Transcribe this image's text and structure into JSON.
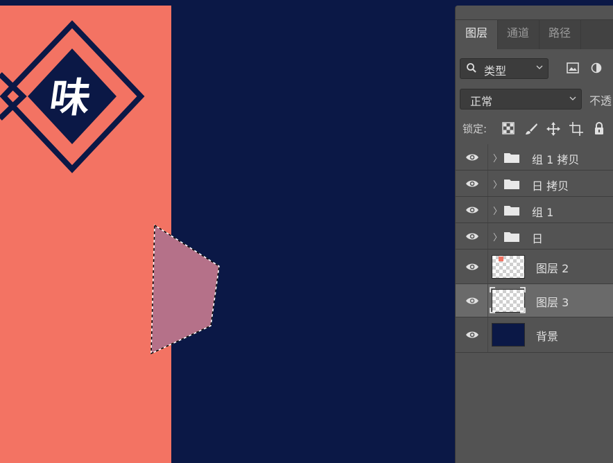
{
  "canvas": {
    "character": "味",
    "colors": {
      "background": "#0b1846",
      "panel": "#f37363",
      "shape": "#b57189"
    }
  },
  "layers_panel": {
    "tabs": [
      {
        "label": "图层",
        "active": true
      },
      {
        "label": "通道",
        "active": false
      },
      {
        "label": "路径",
        "active": false
      }
    ],
    "filter_label": "类型",
    "blend_mode": "正常",
    "opacity_label": "不透",
    "lock_label": "锁定:",
    "layers": [
      {
        "name": "组 1 拷贝",
        "kind": "group",
        "visible": true,
        "selected": false
      },
      {
        "name": "日 拷贝",
        "kind": "group",
        "visible": true,
        "selected": false
      },
      {
        "name": "组 1",
        "kind": "group",
        "visible": true,
        "selected": false
      },
      {
        "name": "日",
        "kind": "group",
        "visible": true,
        "selected": false
      },
      {
        "name": "图层 2",
        "kind": "pixel",
        "visible": true,
        "selected": false
      },
      {
        "name": "图层 3",
        "kind": "pixel",
        "visible": true,
        "selected": true
      },
      {
        "name": "背景",
        "kind": "background",
        "visible": true,
        "selected": false
      }
    ]
  }
}
